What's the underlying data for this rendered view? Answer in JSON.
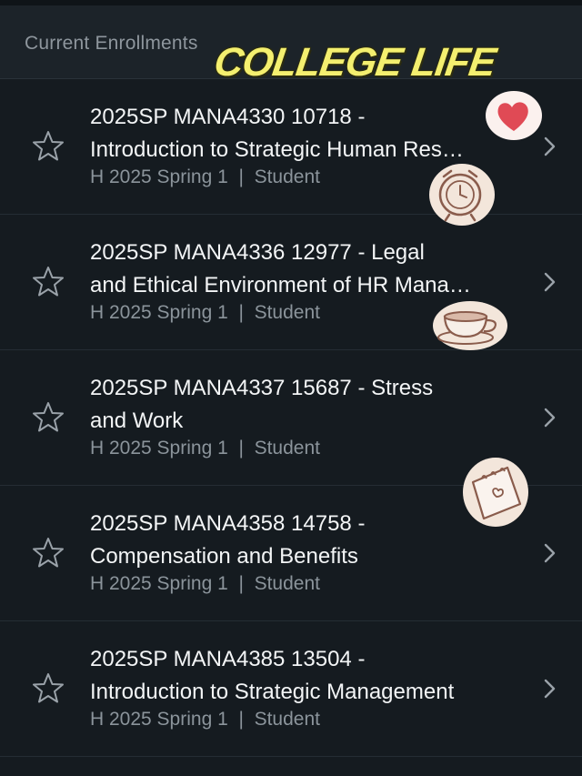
{
  "header": {
    "section_title": "Current Enrollments",
    "sticker_title": "COLLEGE LIFE"
  },
  "enrollments": [
    {
      "title": "2025SP MANA4330 10718 -\nIntroduction to Strategic Human Res…",
      "term": "H 2025 Spring 1",
      "separator": "|",
      "role": "Student"
    },
    {
      "title": "2025SP MANA4336 12977 - Legal\nand Ethical Environment of HR Mana…",
      "term": "H 2025 Spring 1",
      "separator": "|",
      "role": "Student"
    },
    {
      "title": "2025SP MANA4337 15687 - Stress\nand Work",
      "term": "H 2025 Spring 1",
      "separator": "|",
      "role": "Student"
    },
    {
      "title": "2025SP MANA4358 14758 -\nCompensation and Benefits",
      "term": "H 2025 Spring 1",
      "separator": "|",
      "role": "Student"
    },
    {
      "title": "2025SP MANA4385 13504 -\nIntroduction to Strategic Management",
      "term": "H 2025 Spring 1",
      "separator": "|",
      "role": "Student"
    }
  ],
  "icons": {
    "favorite": "star-outline-icon",
    "open": "chevron-right-icon",
    "stickers": [
      "heart-sticker",
      "alarm-clock-sticker",
      "coffee-cup-sticker",
      "notepad-sticker"
    ]
  },
  "colors": {
    "background": "#151b20",
    "header_background": "#1c2329",
    "title_text": "#f3f5f6",
    "meta_text": "#8b949b",
    "sticker_yellow": "#f4ef6f",
    "heart_red": "#e04a55"
  }
}
